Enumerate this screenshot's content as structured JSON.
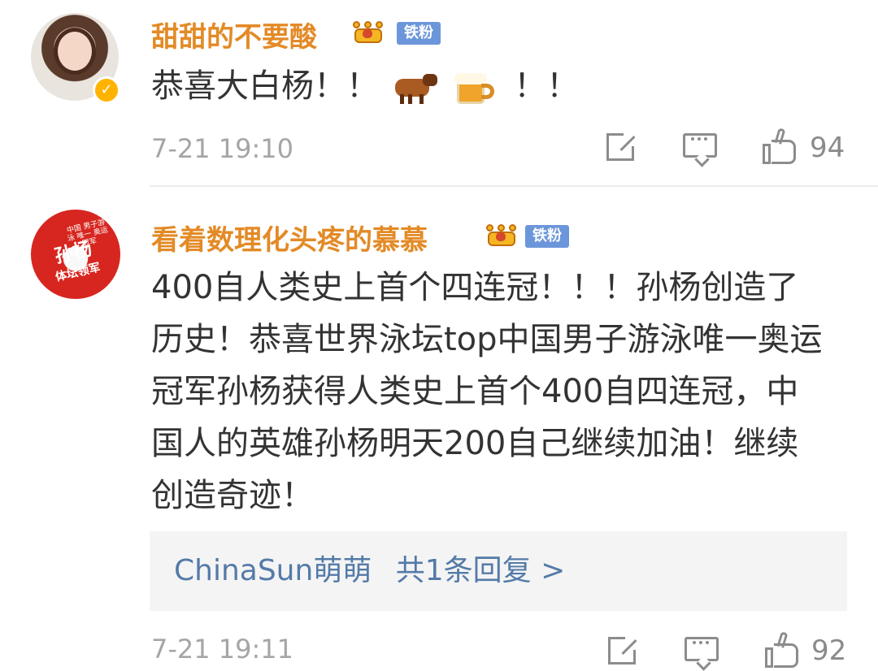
{
  "comments": [
    {
      "username": "甜甜的不要酸",
      "badge": "铁粉",
      "content_before": "恭喜大白杨！！",
      "content_after": "！！",
      "emoji_names": [
        "cow-emoji",
        "beer-mug-emoji"
      ],
      "timestamp": "7-21 19:10",
      "likes": "94"
    },
    {
      "username": "看着数理化头疼的慕慕",
      "badge": "铁粉",
      "avatar_text": "孙杨",
      "avatar_subtext": "体坛领军",
      "avatar_small_text": "中国 男子游泳 唯一 奥运冠军",
      "content": "400自人类史上首个四连冠！！！孙杨创造了历史！恭喜世界泳坛top中国男子游泳唯一奥运冠军孙杨获得人类史上首个400自四连冠，中国人的英雄孙杨明天200自己继续加油！继续创造奇迹！",
      "reply": {
        "user": "ChinaSun萌萌",
        "text": "共1条回复 >"
      },
      "timestamp": "7-21 19:11",
      "likes": "92"
    }
  ],
  "icons": {
    "verified": "verified-badge-icon",
    "crown": "crown-icon",
    "share": "share-icon",
    "comment": "comment-icon",
    "like": "thumbs-up-icon"
  },
  "colors": {
    "username": "#e38a26",
    "badge": "#6c96da",
    "reply_link": "#547aa8",
    "meta_text": "#a5a5a5",
    "action_icon": "#8c8c8c",
    "reply_background": "#f4f4f4"
  }
}
